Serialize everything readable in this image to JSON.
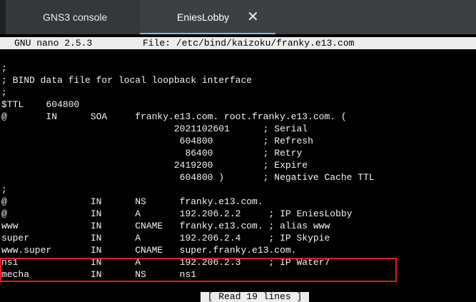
{
  "tabs": [
    {
      "label": "GNS3 console"
    },
    {
      "label": "EniesLobby",
      "close": "✕"
    }
  ],
  "nano": {
    "version": "GNU nano 2.5.3",
    "file": "File: /etc/bind/kaizoku/franky.e13.com",
    "message": "[ Read 19 lines ]"
  },
  "lines": [
    ";",
    "; BIND data file for local loopback interface",
    ";",
    "$TTL    604800",
    "@       IN      SOA     franky.e13.com. root.franky.e13.com. (",
    "                               2021102601      ; Serial",
    "                                604800         ; Refresh",
    "                                 86400         ; Retry",
    "                               2419200         ; Expire",
    "                                604800 )       ; Negative Cache TTL",
    ";",
    "@               IN      NS      franky.e13.com.",
    "@               IN      A       192.206.2.2     ; IP EniesLobby",
    "www             IN      CNAME   franky.e13.com. ; alias www",
    "super           IN      A       192.206.2.4     ; IP Skypie",
    "www.super       IN      CNAME   super.franky.e13.com.",
    "ns1             IN      A       192.206.2.3     ; IP Water7",
    "mecha           IN      NS      ns1"
  ],
  "colors": {
    "highlight": "#e01b24",
    "tab_accent": "#8ab4f8"
  }
}
